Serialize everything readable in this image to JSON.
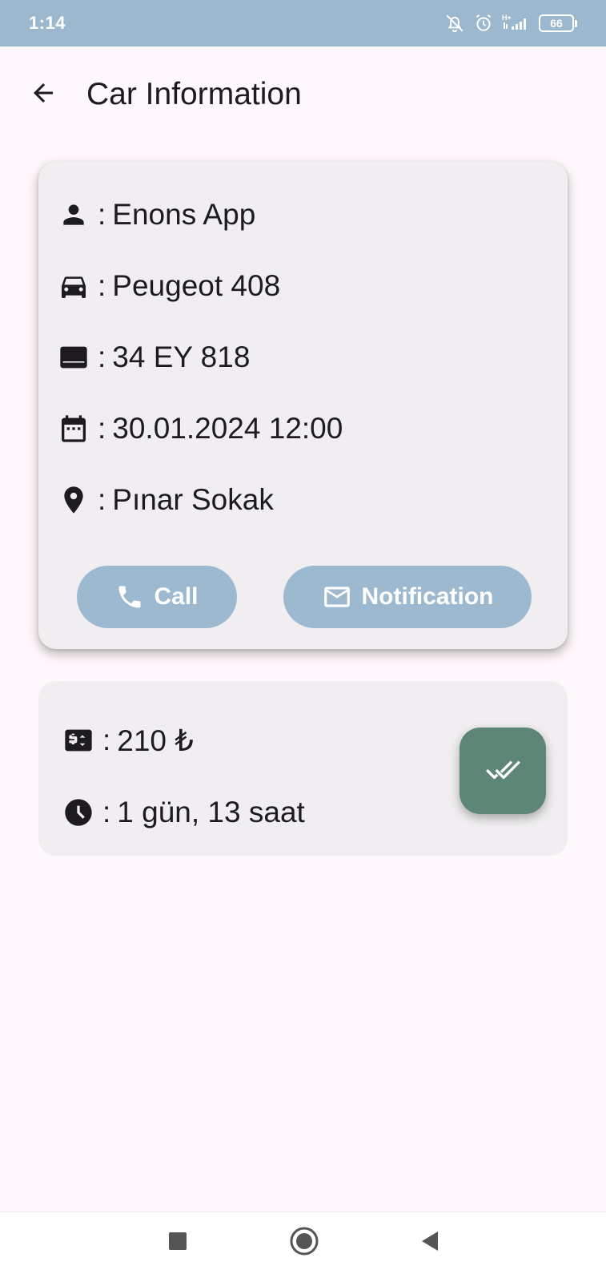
{
  "status_bar": {
    "time": "1:14",
    "battery": "66",
    "icons": [
      "mute-icon",
      "alarm-icon",
      "signal-icon",
      "battery-icon"
    ]
  },
  "app_bar": {
    "title": "Car Information",
    "back_icon": "arrow-back-icon"
  },
  "car_card": {
    "rows": [
      {
        "icon": "person-icon",
        "separator": ":",
        "value": "Enons App"
      },
      {
        "icon": "car-icon",
        "separator": ":",
        "value": "Peugeot 408"
      },
      {
        "icon": "license-plate-icon",
        "separator": ":",
        "value": "34 EY 818"
      },
      {
        "icon": "calendar-icon",
        "separator": ":",
        "value": "30.01.2024 12:00"
      },
      {
        "icon": "location-pin-icon",
        "separator": ":",
        "value": "Pınar Sokak"
      }
    ],
    "buttons": {
      "call_label": "Call",
      "notification_label": "Notification"
    }
  },
  "fee_card": {
    "rows": [
      {
        "icon": "price-tag-icon",
        "separator": ":",
        "value": "210 ₺"
      },
      {
        "icon": "clock-icon",
        "separator": ":",
        "value": "1 gün, 13 saat"
      }
    ],
    "confirm_icon": "double-check-icon"
  },
  "colors": {
    "status_bar": "#9bb8ce",
    "pill_button": "#9db9cf",
    "fab": "#5e8677",
    "card": "#f0eef0",
    "background": "#fef7fb"
  },
  "nav_bar": {
    "icons": [
      "recents-square-icon",
      "home-circle-icon",
      "back-triangle-icon"
    ]
  }
}
